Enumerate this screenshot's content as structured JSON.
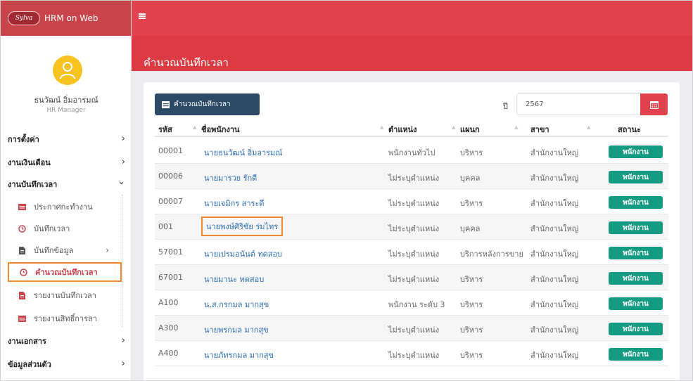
{
  "app": {
    "brand_logo_text": "Sylva",
    "brand_name": "HRM on Web"
  },
  "user": {
    "name": "ธนวัฒน์ อิ่มอารมณ์",
    "role": "HR Manager"
  },
  "sidebar": {
    "items": [
      {
        "label": "การตั้งค่า",
        "chevron": "›"
      },
      {
        "label": "งานเงินเดือน",
        "chevron": "›"
      },
      {
        "label": "งานบันทึกเวลา",
        "chevron": "⌄"
      },
      {
        "label": "งานเอกสาร",
        "chevron": "›"
      },
      {
        "label": "ข้อมูลส่วนตัว",
        "chevron": "›"
      }
    ],
    "submenu": [
      {
        "label": "ประกาศกะทำงาน",
        "icon": "calendar-icon"
      },
      {
        "label": "บันทึกเวลา",
        "icon": "clock-icon"
      },
      {
        "label": "บันทึกข้อมูล",
        "icon": "file-icon",
        "chevron": "›"
      },
      {
        "label": "คำนวณบันทึกเวลา",
        "icon": "clock-icon",
        "active": true
      },
      {
        "label": "รายงานบันทึกเวลา",
        "icon": "file-icon"
      },
      {
        "label": "รายงานสิทธิ์การลา",
        "icon": "calendar-icon"
      }
    ]
  },
  "page": {
    "title": "คำนวณบันทึกเวลา"
  },
  "toolbar": {
    "calc_button": "คำนวณบันทึกเวลา",
    "year_label": "ปี",
    "year_value": "2567"
  },
  "table": {
    "headers": [
      "รหัส",
      "ชื่อพนักงาน",
      "ตำแหน่ง",
      "แผนก",
      "สาขา",
      "สถานะ"
    ],
    "rows": [
      {
        "code": "00001",
        "name": "นายธนวัฒน์ อิ่มอารมณ์",
        "position": "พนักงานทั่วไป",
        "dept": "บริหาร",
        "branch": "สำนักงานใหญ่",
        "status": "พนักงาน"
      },
      {
        "code": "00006",
        "name": "นายมารวย รักดี",
        "position": "ไม่ระบุตำแหน่ง",
        "dept": "บุคคล",
        "branch": "สำนักงานใหญ่",
        "status": "พนักงาน"
      },
      {
        "code": "00007",
        "name": "นายเจมิกร สาระดี",
        "position": "ไม่ระบุตำแหน่ง",
        "dept": "บริหาร",
        "branch": "สำนักงานใหญ่",
        "status": "พนักงาน"
      },
      {
        "code": "001",
        "name": "นายพงษ์ศิริชัย ร่มไทร",
        "position": "ไม่ระบุตำแหน่ง",
        "dept": "บุคคล",
        "branch": "สำนักงานใหญ่",
        "status": "พนักงาน",
        "highlight": true
      },
      {
        "code": "57001",
        "name": "นายเปรมอนันต์ ทดสอบ",
        "position": "ไม่ระบุตำแหน่ง",
        "dept": "บริการหลังการขาย",
        "branch": "สำนักงานใหญ่",
        "status": "พนักงาน"
      },
      {
        "code": "67001",
        "name": "นายมานะ ทดสอบ",
        "position": "ไม่ระบุตำแหน่ง",
        "dept": "บริหาร",
        "branch": "สำนักงานใหญ่",
        "status": "พนักงาน"
      },
      {
        "code": "A100",
        "name": "น.ส.กรกมล มากสุข",
        "position": "พนักงาน ระดับ 3",
        "dept": "บริหาร",
        "branch": "สำนักงานใหญ่",
        "status": "พนักงาน"
      },
      {
        "code": "A300",
        "name": "นายพรกมล มากสุข",
        "position": "ไม่ระบุตำแหน่ง",
        "dept": "บริหาร",
        "branch": "สำนักงานใหญ่",
        "status": "พนักงาน"
      },
      {
        "code": "A400",
        "name": "นายภัทรกมล มากสุข",
        "position": "ไม่ระบุตำแหน่ง",
        "dept": "บริหาร",
        "branch": "สำนักงานใหญ่",
        "status": "พนักงาน"
      }
    ]
  },
  "colors": {
    "header_red": "#e1424b",
    "title_band": "#dd3a44",
    "button_navy": "#2c4a66",
    "status_green": "#169b83",
    "highlight_orange": "#f0882d",
    "link_blue": "#2b6cb0"
  }
}
